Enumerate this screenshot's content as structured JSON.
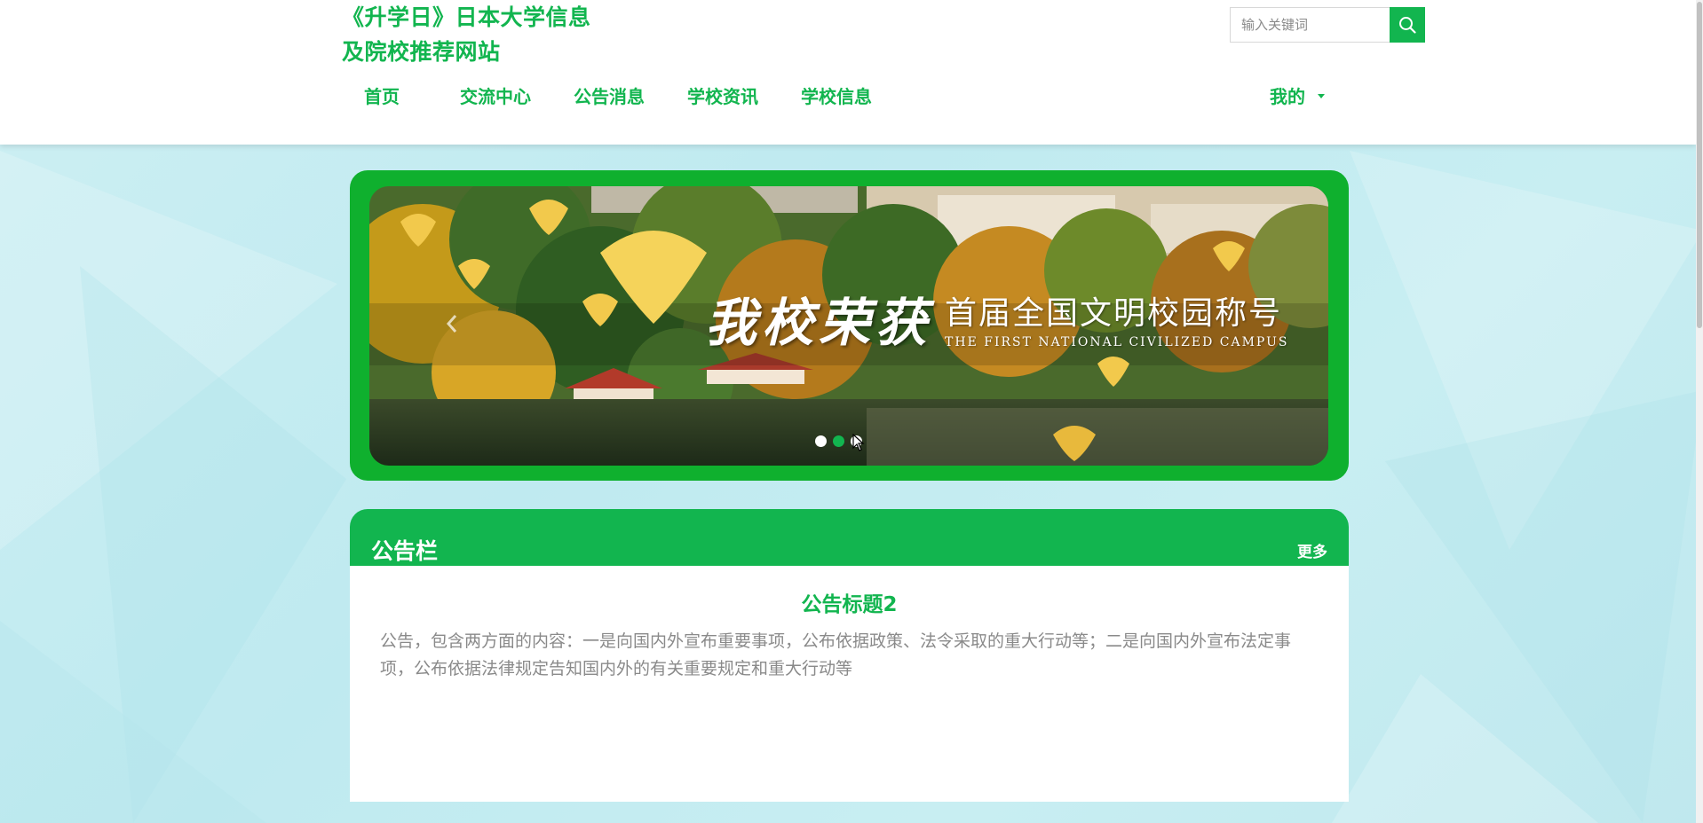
{
  "site": {
    "title_line1": "《升学日》日本大学信息",
    "title_line2": "及院校推荐网站"
  },
  "search": {
    "placeholder": "输入关键词",
    "icon": "search-icon"
  },
  "nav": {
    "items": [
      {
        "label": "首页"
      },
      {
        "label": "交流中心"
      },
      {
        "label": "公告消息"
      },
      {
        "label": "学校资讯"
      },
      {
        "label": "学校信息"
      }
    ],
    "me_label": "我的",
    "me_icon": "caret-down-icon"
  },
  "carousel": {
    "slogan_main": "我校荣获",
    "slogan_cn": "首届全国文明校园称号",
    "slogan_en": "THE FIRST NATIONAL CIVILIZED CAMPUS",
    "slide_count": 3,
    "active_index": 1
  },
  "notice": {
    "header_title": "公告栏",
    "more_label": "更多",
    "item_title": "公告标题2",
    "item_text": "公告，包含两方面的内容：一是向国内外宣布重要事项，公布依据政策、法令采取的重大行动等；二是向国内外宣布法定事项，公布依据法律规定告知国内外的有关重要规定和重大行动等"
  },
  "colors": {
    "brand_green": "#12b54f",
    "frame_green": "#0fb02e",
    "background": "#c8eef2"
  }
}
